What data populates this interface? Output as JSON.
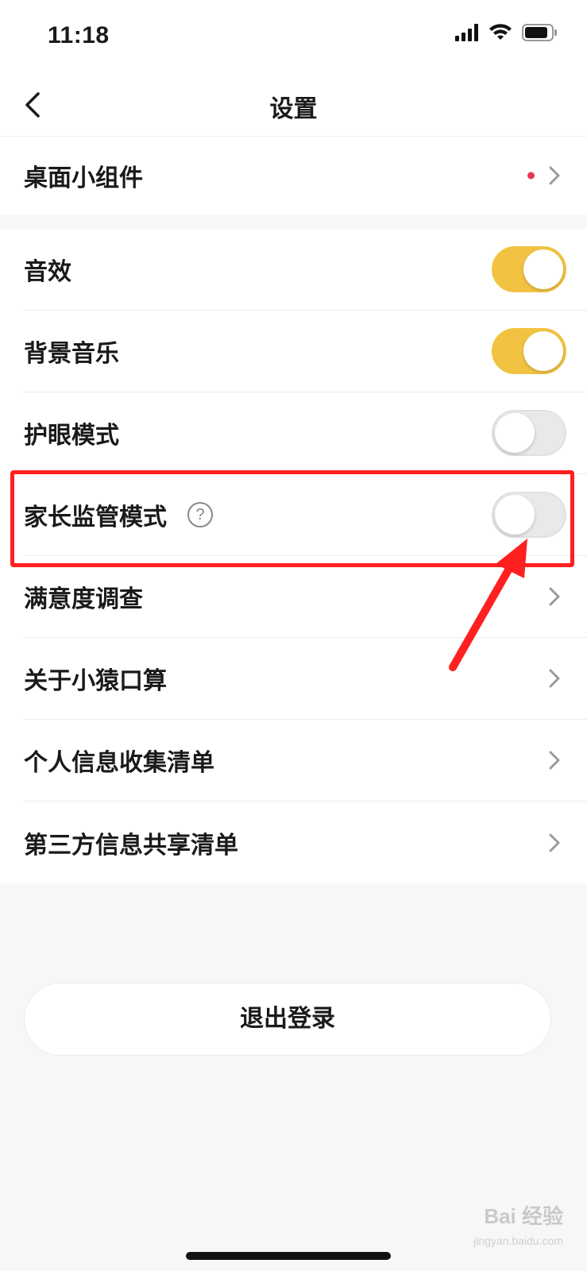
{
  "status_bar": {
    "time": "11:18",
    "signal_icon": "signal-bars-icon",
    "wifi_icon": "wifi-icon",
    "battery_icon": "battery-icon"
  },
  "nav": {
    "title": "设置",
    "back_icon": "chevron-left-icon"
  },
  "widgets_row": {
    "label": "桌面小组件",
    "has_red_dot": true
  },
  "toggles": [
    {
      "label": "音效",
      "on": true
    },
    {
      "label": "背景音乐",
      "on": true
    },
    {
      "label": "护眼模式",
      "on": false
    },
    {
      "label": "家长监管模式",
      "on": false,
      "help": "?"
    }
  ],
  "links": [
    {
      "label": "满意度调查"
    },
    {
      "label": "关于小猿口算"
    },
    {
      "label": "个人信息收集清单"
    },
    {
      "label": "第三方信息共享清单"
    }
  ],
  "logout": {
    "label": "退出登录"
  },
  "watermark": {
    "text": "Bai 经验",
    "sub": "jingyan.baidu.com"
  },
  "colors": {
    "toggle_on": "#f2c343",
    "toggle_off": "#e9e9eb",
    "highlight": "#ff2020",
    "red_dot": "#e8384f"
  }
}
